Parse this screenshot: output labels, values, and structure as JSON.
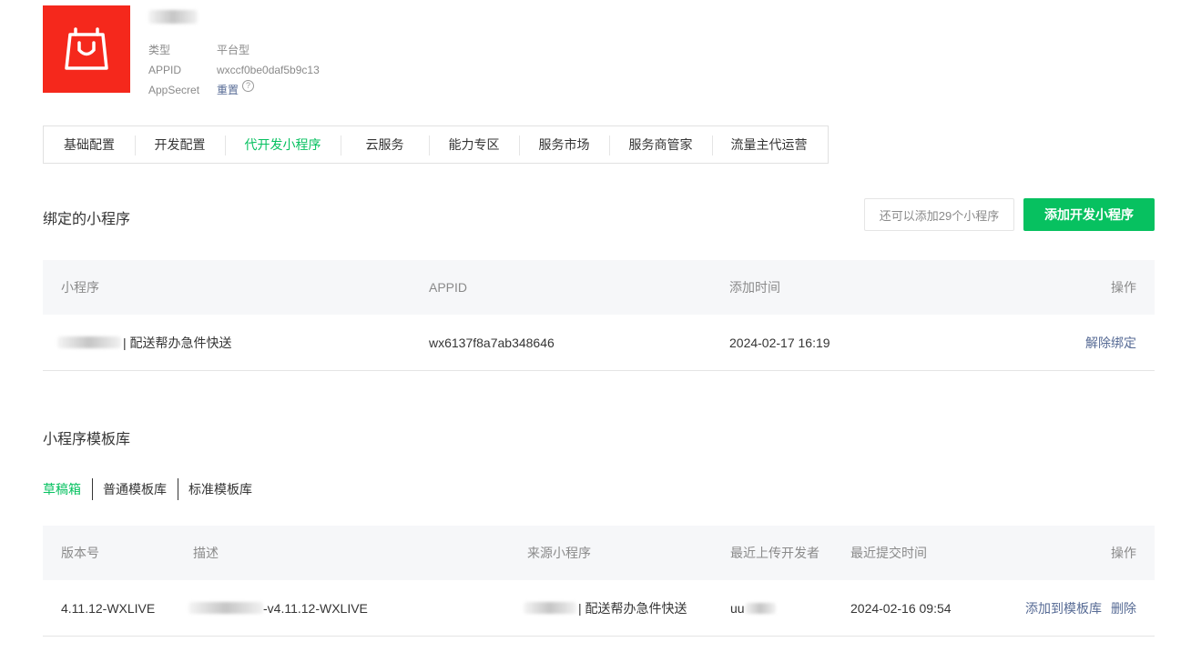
{
  "app": {
    "info": [
      {
        "label": "类型",
        "value": "平台型"
      },
      {
        "label": "APPID",
        "value": "wxccf0be0daf5b9c13"
      },
      {
        "label": "AppSecret",
        "value": "重置"
      }
    ]
  },
  "tabs": [
    "基础配置",
    "开发配置",
    "代开发小程序",
    "云服务",
    "能力专区",
    "服务市场",
    "服务商管家",
    "流量主代运营"
  ],
  "active_tab": "代开发小程序",
  "bound": {
    "title": "绑定的小程序",
    "quota": "还可以添加29个小程序",
    "add_button": "添加开发小程序",
    "columns": [
      "小程序",
      "APPID",
      "添加时间",
      "操作"
    ],
    "rows": [
      {
        "name": "| 配送帮办急件快送",
        "appid": "wx6137f8a7ab348646",
        "time": "2024-02-17 16:19",
        "action": "解除绑定"
      }
    ]
  },
  "templates": {
    "title": "小程序模板库",
    "subtabs": [
      "草稿箱",
      "普通模板库",
      "标准模板库"
    ],
    "columns": [
      "版本号",
      "描述",
      "来源小程序",
      "最近上传开发者",
      "最近提交时间",
      "操作"
    ],
    "rows": [
      {
        "version": "4.11.12-WXLIVE",
        "desc": "-v4.11.12-WXLIVE",
        "source": "| 配送帮办急件快送",
        "dev": "uu",
        "time": "2024-02-16 09:54",
        "action1": "添加到模板库",
        "action2": "删除"
      }
    ]
  },
  "colors": {
    "accent": "#07c160",
    "link": "#576b95",
    "logo_bg": "#f5281c"
  }
}
